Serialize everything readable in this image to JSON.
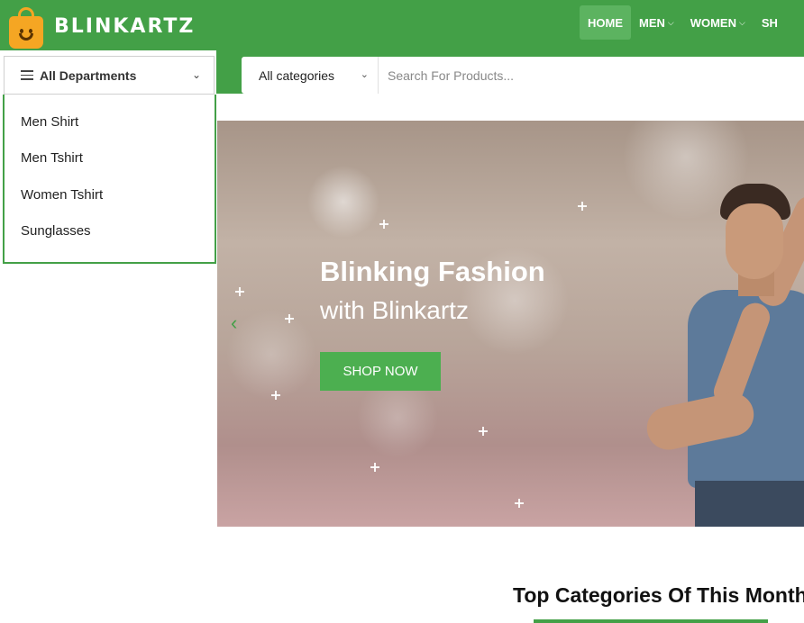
{
  "brand": {
    "name": "BLINKARTZ",
    "logo_icon": "shopping-bag-smile-icon",
    "primary_color": "#43a047",
    "logo_color": "#f5a623"
  },
  "nav": {
    "items": [
      {
        "label": "HOME",
        "active": true
      },
      {
        "label": "MEN",
        "caret": "⌵"
      },
      {
        "label": "WOMEN",
        "caret": "⌵"
      },
      {
        "label": "SH"
      }
    ]
  },
  "departments": {
    "label": "All Departments",
    "items": [
      "Men Shirt",
      "Men Tshirt",
      "Women Tshirt",
      "Sunglasses"
    ]
  },
  "search": {
    "category": "All categories",
    "placeholder": "Search For Products..."
  },
  "hero": {
    "title": "Blinking Fashion",
    "subtitle": "with Blinkartz",
    "cta": "SHOP NOW",
    "prev_icon": "chevron-left-icon"
  },
  "section": {
    "title": "Top Categories Of This Month"
  }
}
